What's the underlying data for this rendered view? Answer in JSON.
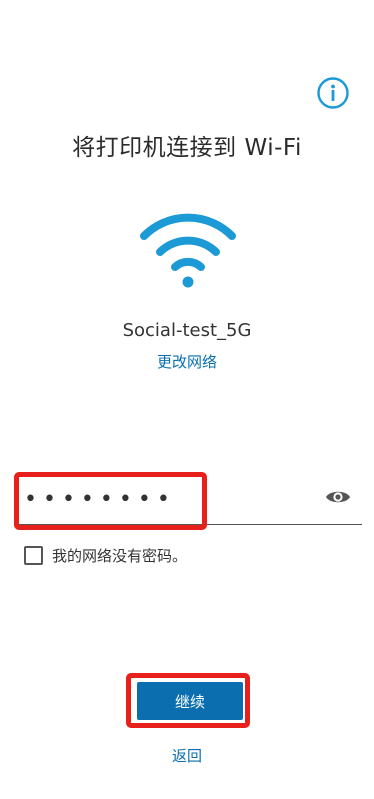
{
  "header": {
    "title": "将打印机连接到 Wi-Fi"
  },
  "network": {
    "ssid": "Social-test_5G",
    "change_label": "更改网络"
  },
  "password": {
    "value": "••••••••"
  },
  "no_password": {
    "label": "我的网络没有密码。",
    "checked": false
  },
  "actions": {
    "continue_label": "继续",
    "back_label": "返回"
  },
  "icons": {
    "info": "info-icon",
    "wifi": "wifi-icon",
    "visibility": "eye-icon"
  },
  "colors": {
    "accent": "#0b6faf",
    "wifi_blue": "#1b9ad6",
    "highlight": "#e8201c",
    "text": "#2b2b2b"
  }
}
